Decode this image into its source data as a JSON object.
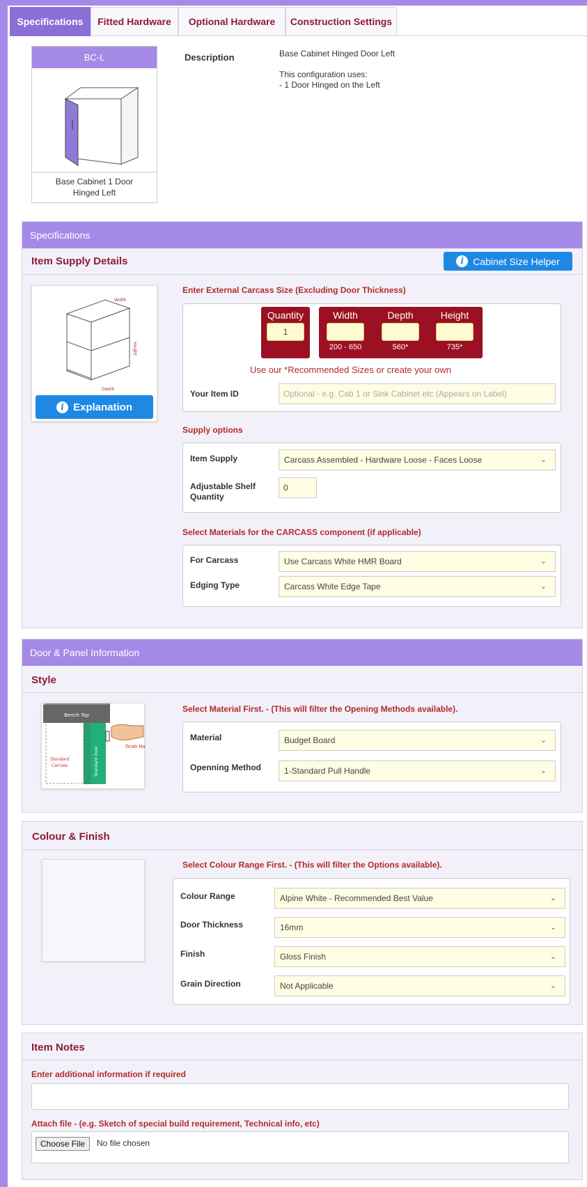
{
  "tabs": [
    "Specifications",
    "Fitted Hardware",
    "Optional Hardware",
    "Construction Settings"
  ],
  "summary": {
    "code": "BC-L",
    "caption": "Base Cabinet 1 Door Hinged Left",
    "description_label": "Description",
    "description_lines": [
      "Base Cabinet Hinged Door Left",
      "",
      "This configuration uses:",
      "- 1 Door Hinged on the Left"
    ]
  },
  "specs": {
    "panel_title": "Specifications",
    "section_title": "Item Supply Details",
    "helper_button": "Cabinet Size Helper",
    "explanation_button": "Explanation",
    "size_label": "Enter External Carcass Size (Excluding Door Thickness)",
    "quantity": {
      "label": "Quantity",
      "value": "1"
    },
    "width": {
      "label": "Width",
      "value": "",
      "hint": "200 - 650"
    },
    "depth": {
      "label": "Depth",
      "value": "",
      "hint": "560*"
    },
    "height": {
      "label": "Height",
      "value": "",
      "hint": "735*"
    },
    "recommended_note": "Use our *Recommended Sizes or create your own",
    "item_id_label": "Your Item ID",
    "item_id_placeholder": "Optional -  e.g. Cab 1 or Sink Cabinet etc  (Appears on Label)",
    "supply_options_label": "Supply options",
    "item_supply_label": "Item Supply",
    "item_supply_value": "Carcass Assembled - Hardware Loose - Faces Loose",
    "shelf_label_1": "Adjustable Shelf",
    "shelf_label_2": "Quantity",
    "shelf_value": "0",
    "carcass_materials_label": "Select Materials for the CARCASS component (if applicable)",
    "for_carcass_label": "For Carcass",
    "for_carcass_value": "Use Carcass White HMR Board",
    "edging_label": "Edging Type",
    "edging_value": "Carcass White Edge Tape"
  },
  "door": {
    "panel_title": "Door & Panel Information",
    "section_title": "Style",
    "material_first_label": "Select Material First. - (This will filter the Opening Methods available).",
    "material_label": "Material",
    "material_value": "Budget Board",
    "opening_label": "Openning Method",
    "opening_value": "1-Standard Pull Handle",
    "image_labels": {
      "bench": "Bench Top",
      "grab": "Grab Handle",
      "carcass_1": "Standard",
      "carcass_2": "Carcass",
      "door": "Standard Door"
    }
  },
  "colour": {
    "section_title": "Colour & Finish",
    "range_first_label": "Select Colour Range First. - (This will filter the Options available).",
    "range_label": "Colour Range",
    "range_value": "Alpine White - Recommended Best Value",
    "thickness_label": "Door Thickness",
    "thickness_value": "16mm",
    "finish_label": "Finish",
    "finish_value": "Gloss Finish",
    "grain_label": "Grain Direction",
    "grain_value": "Not Applicable"
  },
  "notes": {
    "section_title": "Item Notes",
    "additional_label": "Enter additional information if required",
    "attach_label": "Attach file - (e.g. Sketch of special build requirement, Technical info, etc)",
    "choose_file": "Choose File",
    "no_file": "No file chosen"
  },
  "colors": {
    "purple": "#a48ae6",
    "maroon": "#8c1c33",
    "red": "#b32b2b",
    "dim_bg": "#9b1022",
    "blue": "#1e88e5",
    "yellow_field": "#fffde3"
  }
}
